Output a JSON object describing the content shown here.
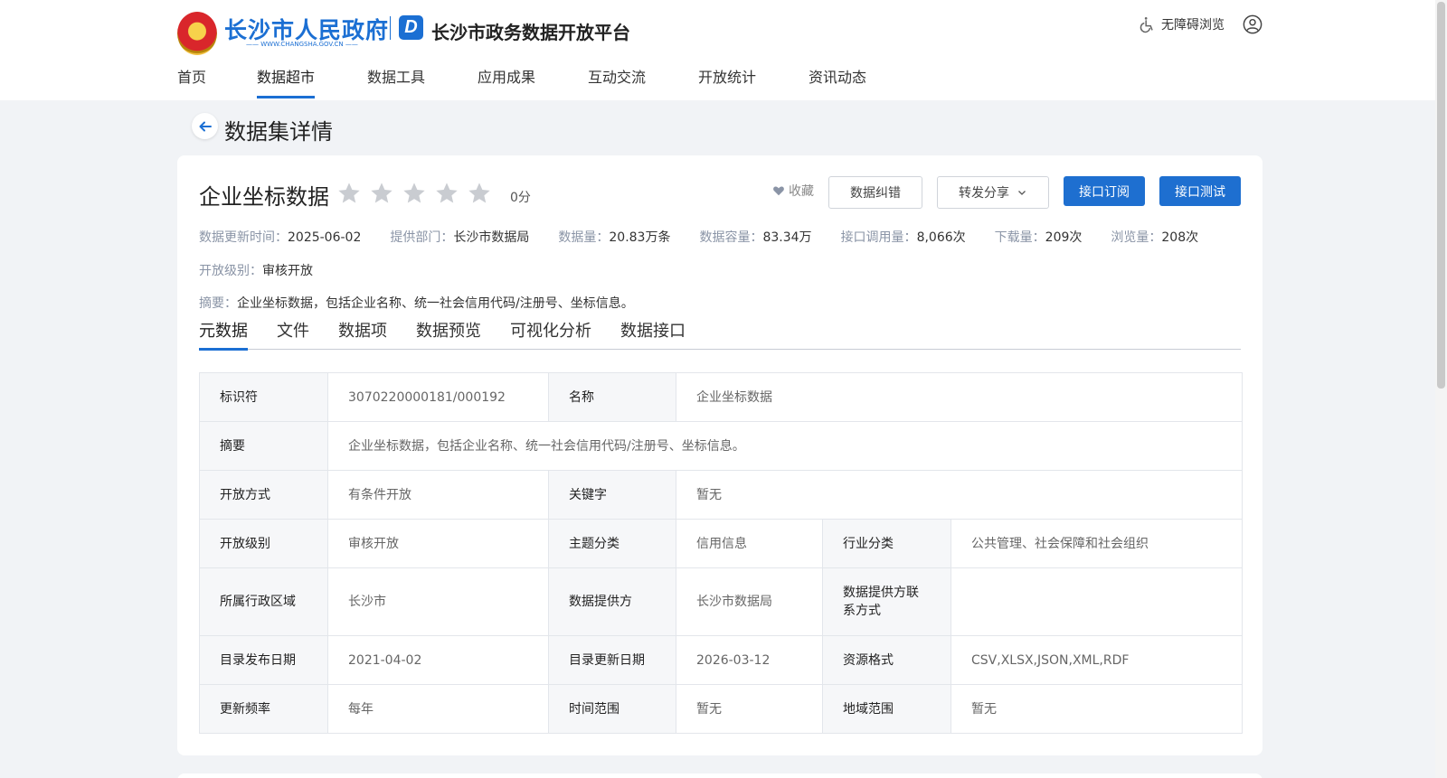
{
  "header": {
    "gov_title": "长沙市人民政府",
    "gov_url": "—— WWW.CHANGSHA.GOV.CN ——",
    "platform_logo_letter": "D",
    "platform_title": "长沙市政务数据开放平台",
    "accessibility_label": "无障碍浏览",
    "accessibility_icon": "wheelchair-icon",
    "user_icon": "user-icon",
    "brand_color": "#1b6fd3"
  },
  "nav": {
    "items": [
      {
        "label": "首页"
      },
      {
        "label": "数据超市",
        "active": true
      },
      {
        "label": "数据工具"
      },
      {
        "label": "应用成果"
      },
      {
        "label": "互动交流"
      },
      {
        "label": "开放统计"
      },
      {
        "label": "资讯动态"
      }
    ]
  },
  "page": {
    "title": "数据集详情",
    "back_icon": "arrow-left-icon"
  },
  "dataset": {
    "name": "企业坐标数据",
    "rating_stars": 0,
    "rating_max": 5,
    "score_label": "0分",
    "favorite_label": "收藏",
    "buttons": {
      "correction": "数据纠错",
      "share": "转发分享",
      "subscribe": "接口订阅",
      "test": "接口测试"
    },
    "meta": {
      "update_time_k": "数据更新时间：",
      "update_time_v": "2025-06-02",
      "dept_k": "提供部门：",
      "dept_v": "长沙市数据局",
      "count_k": "数据量：",
      "count_v": "20.83万条",
      "capacity_k": "数据容量：",
      "capacity_v": "83.34万",
      "api_calls_k": "接口调用量：",
      "api_calls_v": "8,066次",
      "downloads_k": "下载量：",
      "downloads_v": "209次",
      "views_k": "浏览量：",
      "views_v": "208次",
      "level_k": "开放级别：",
      "level_v": "审核开放",
      "summary_k": "摘要：",
      "summary_v": "企业坐标数据，包括企业名称、统一社会信用代码/注册号、坐标信息。"
    }
  },
  "tabs": [
    {
      "label": "元数据",
      "active": true
    },
    {
      "label": "文件"
    },
    {
      "label": "数据项"
    },
    {
      "label": "数据预览"
    },
    {
      "label": "可视化分析"
    },
    {
      "label": "数据接口"
    }
  ],
  "metadata_table": {
    "identifier_k": "标识符",
    "identifier_v": "3070220000181/000192",
    "name_k": "名称",
    "name_v": "企业坐标数据",
    "summary_k": "摘要",
    "summary_v": "企业坐标数据，包括企业名称、统一社会信用代码/注册号、坐标信息。",
    "open_mode_k": "开放方式",
    "open_mode_v": "有条件开放",
    "keywords_k": "关键字",
    "keywords_v": "暂无",
    "open_level_k": "开放级别",
    "open_level_v": "审核开放",
    "topic_k": "主题分类",
    "topic_v": "信用信息",
    "industry_k": "行业分类",
    "industry_v": "公共管理、社会保障和社会组织",
    "region_k": "所属行政区域",
    "region_v": "长沙市",
    "provider_k": "数据提供方",
    "provider_v": "长沙市数据局",
    "contact_k": "数据提供方联系方式",
    "contact_v": "",
    "publish_date_k": "目录发布日期",
    "publish_date_v": "2021-04-02",
    "update_date_k": "目录更新日期",
    "update_date_v": "2026-03-12",
    "format_k": "资源格式",
    "format_v": "CSV,XLSX,JSON,XML,RDF",
    "frequency_k": "更新频率",
    "frequency_v": "每年",
    "time_range_k": "时间范围",
    "time_range_v": "暂无",
    "geo_range_k": "地域范围",
    "geo_range_v": "暂无"
  }
}
